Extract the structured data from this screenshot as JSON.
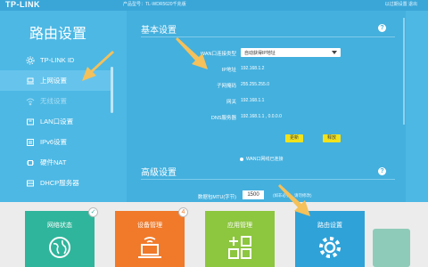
{
  "header": {
    "logo": "TP-LINK",
    "model": "产品型号：TL-WDR5620千兆版",
    "right_links": "以过期设置    退出"
  },
  "sidebar": {
    "title": "路由设置",
    "items": [
      {
        "label": "TP-LINK ID",
        "icon": "id-icon"
      },
      {
        "label": "上网设置",
        "icon": "laptop-icon"
      },
      {
        "label": "无线设置",
        "icon": "wifi-icon"
      },
      {
        "label": "LAN口设置",
        "icon": "lan-icon"
      },
      {
        "label": "IPv6设置",
        "icon": "ipv6-icon"
      },
      {
        "label": "硬件NAT",
        "icon": "chip-icon"
      },
      {
        "label": "DHCP服务器",
        "icon": "dhcp-icon"
      }
    ]
  },
  "basic": {
    "title": "基本设置",
    "wan_type_label": "WAN口连接类型",
    "wan_type_value": "自动获得IP地址",
    "ip_label": "IP地址",
    "ip_value": "192.168.1.2",
    "mask_label": "子网掩码",
    "mask_value": "255.255.255.0",
    "gateway_label": "网关",
    "gateway_value": "192.168.1.1",
    "dns_label": "DNS服务器",
    "dns_value": "192.168.1.1 , 0.0.0.0",
    "renew_label": "更新",
    "release_label": "释放",
    "wan_link_label": "WAN口网线已连接"
  },
  "advanced": {
    "title": "高级设置",
    "mtu_label": "数据包MTU(字节)",
    "mtu_value": "1500",
    "mtu_hint": "(如非必要，请勿修改)"
  },
  "dock": {
    "tiles": [
      {
        "label": "网络状态",
        "color": "#2fb59b",
        "icon": "globe-icon",
        "badge": "✓"
      },
      {
        "label": "设备管理",
        "color": "#f07a2a",
        "icon": "laptop-icon",
        "badge": "4"
      },
      {
        "label": "应用管理",
        "color": "#8dc63f",
        "icon": "apps-icon"
      },
      {
        "label": "路由设置",
        "color": "#2fa2d8",
        "icon": "gear-icon"
      }
    ]
  },
  "colors": {
    "background": "#4db8e4",
    "panel": "#44b0de",
    "button_yellow": "#f2e21b",
    "arrow": "#f5c15a"
  }
}
